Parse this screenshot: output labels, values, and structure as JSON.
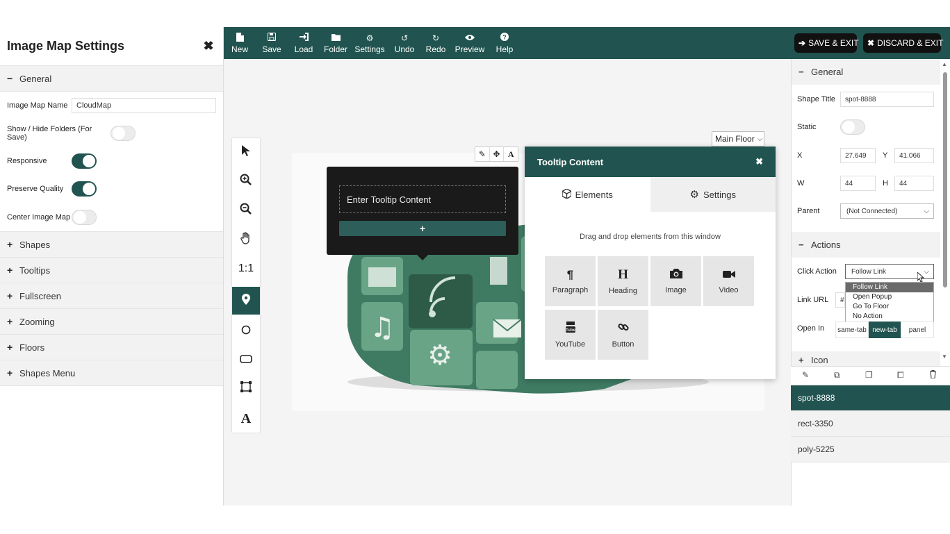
{
  "left_panel": {
    "title": "Image Map Settings",
    "close_icon": "✖",
    "sections": {
      "general": "General",
      "shapes": "Shapes",
      "tooltips": "Tooltips",
      "fullscreen": "Fullscreen",
      "zooming": "Zooming",
      "floors": "Floors",
      "shapes_menu": "Shapes Menu"
    },
    "fields": {
      "image_map_name_label": "Image Map Name",
      "image_map_name_value": "CloudMap",
      "show_hide_folders_label": "Show / Hide Folders (For Save)",
      "show_hide_folders_on": false,
      "responsive_label": "Responsive",
      "responsive_on": true,
      "preserve_quality_label": "Preserve Quality",
      "preserve_quality_on": true,
      "center_image_map_label": "Center Image Map",
      "center_image_map_on": false
    }
  },
  "toolbar": {
    "items": {
      "new": "New",
      "save": "Save",
      "load": "Load",
      "folder": "Folder",
      "settings": "Settings",
      "undo": "Undo",
      "redo": "Redo",
      "preview": "Preview",
      "help": "Help"
    },
    "save_exit": "SAVE & EXIT",
    "discard_exit": "DISCARD & EXIT",
    "accent_color": "#215450"
  },
  "canvas": {
    "floor_select": "Main Floor",
    "zoom_reset_label": "1:1",
    "tooltip_placeholder": "Enter Tooltip Content",
    "tooltip_add": "+"
  },
  "tooltip_window": {
    "title": "Tooltip Content",
    "close": "✖",
    "tab_elements": "Elements",
    "tab_settings": "Settings",
    "hint": "Drag and drop elements from this window",
    "elements": {
      "paragraph": "Paragraph",
      "heading": "Heading",
      "image": "Image",
      "video": "Video",
      "youtube": "YouTube",
      "button": "Button"
    }
  },
  "right_panel": {
    "general_title": "General",
    "shape_title_label": "Shape Title",
    "shape_title_value": "spot-8888",
    "static_label": "Static",
    "static_on": false,
    "x_label": "X",
    "x_value": "27.649",
    "y_label": "Y",
    "y_value": "41.066",
    "w_label": "W",
    "w_value": "44",
    "h_label": "H",
    "h_value": "44",
    "parent_label": "Parent",
    "parent_value": "(Not Connected)",
    "actions_title": "Actions",
    "click_action_label": "Click Action",
    "click_action_value": "Follow Link",
    "click_action_options": {
      "follow_link": "Follow Link",
      "open_popup": "Open Popup",
      "go_to_floor": "Go To Floor",
      "no_action": "No Action"
    },
    "link_url_label": "Link URL",
    "link_url_value": "#",
    "open_in_label": "Open In",
    "open_in_options": {
      "same_tab": "same-tab",
      "new_tab": "new-tab",
      "panel": "panel"
    },
    "open_in_selected": "new-tab",
    "icon_title": "Icon"
  },
  "shapes_list": {
    "items": {
      "s1": "spot-8888",
      "s2": "rect-3350",
      "s3": "poly-5225"
    },
    "selected": "spot-8888"
  }
}
